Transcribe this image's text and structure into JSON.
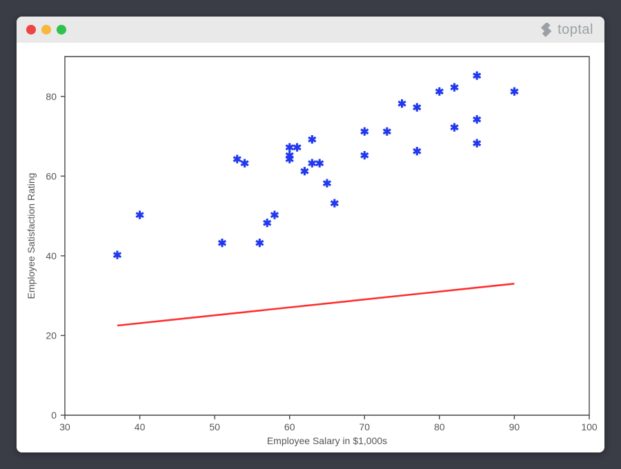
{
  "brand": {
    "name": "toptal"
  },
  "chart_data": {
    "type": "scatter",
    "title": "",
    "xlabel": "Employee Salary in $1,000s",
    "ylabel": "Employee Satisfaction Rating",
    "xlim": [
      30,
      100
    ],
    "ylim": [
      0,
      90
    ],
    "xticks": [
      30,
      40,
      50,
      60,
      70,
      80,
      90,
      100
    ],
    "yticks": [
      0,
      20,
      40,
      60,
      80
    ],
    "series": [
      {
        "name": "observations",
        "style": "marker-asterisk",
        "color": "#2139ee",
        "points": [
          [
            37,
            40
          ],
          [
            40,
            50
          ],
          [
            51,
            43
          ],
          [
            53,
            64
          ],
          [
            54,
            63
          ],
          [
            56,
            43
          ],
          [
            57,
            48
          ],
          [
            58,
            50
          ],
          [
            60,
            67
          ],
          [
            60,
            64
          ],
          [
            60,
            65
          ],
          [
            61,
            67
          ],
          [
            62,
            61
          ],
          [
            63,
            69
          ],
          [
            63,
            63
          ],
          [
            64,
            63
          ],
          [
            65,
            58
          ],
          [
            66,
            53
          ],
          [
            70,
            65
          ],
          [
            70,
            71
          ],
          [
            73,
            71
          ],
          [
            75,
            78
          ],
          [
            77,
            77
          ],
          [
            77,
            66
          ],
          [
            80,
            81
          ],
          [
            82,
            72
          ],
          [
            82,
            82
          ],
          [
            85,
            85
          ],
          [
            85,
            68
          ],
          [
            85,
            74
          ],
          [
            90,
            81
          ]
        ]
      },
      {
        "name": "regression-line",
        "style": "line",
        "color": "#ff2d2d",
        "points": [
          [
            37,
            22.5
          ],
          [
            90,
            33.0
          ]
        ]
      }
    ]
  }
}
